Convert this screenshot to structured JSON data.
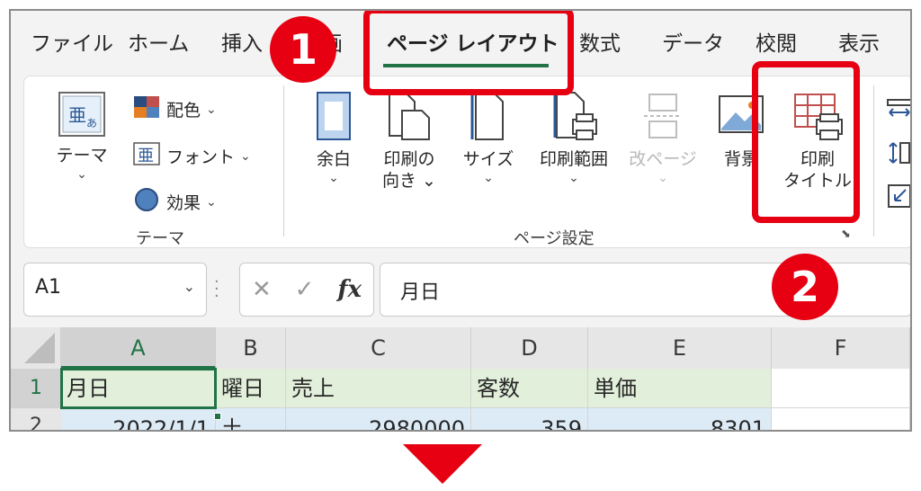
{
  "tabs": [
    "ファイル",
    "ホーム",
    "挿入",
    "画",
    "ページ レイアウト",
    "数式",
    "データ",
    "校閲",
    "表示"
  ],
  "ribbon": {
    "theme_button": "テーマ",
    "colors": "配色",
    "fonts": "フォント",
    "effects": "効果",
    "theme_group": "テーマ",
    "margins": "余白",
    "orientation_line1": "印刷の",
    "orientation_line2": "向き",
    "size": "サイズ",
    "print_area": "印刷範囲",
    "breaks": "改ページ",
    "background": "背景",
    "print_titles_line1": "印刷",
    "print_titles_line2": "タイトル",
    "page_setup_group": "ページ設定"
  },
  "formula_bar": {
    "name_box": "A1",
    "fx_label": "fx",
    "formula": "月日"
  },
  "grid": {
    "columns": [
      "A",
      "B",
      "C",
      "D",
      "E",
      "F"
    ],
    "rows": [
      {
        "num": "1",
        "cells": [
          "月日",
          "曜日",
          "売上",
          "客数",
          "単価",
          ""
        ]
      },
      {
        "num": "2",
        "cells": [
          "2022/1/1",
          "土",
          "2980000",
          "359",
          "8301",
          ""
        ]
      }
    ]
  },
  "callouts": {
    "step1": "1",
    "step2": "2"
  },
  "colors": {
    "highlight": "#e60012",
    "excel_green": "#217346"
  }
}
